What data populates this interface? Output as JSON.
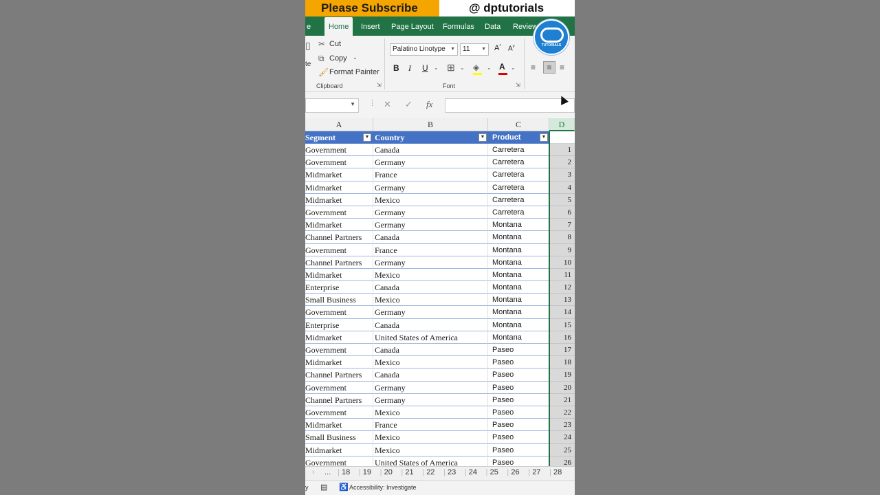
{
  "banner": {
    "subscribe": "Please Subscribe",
    "handle": "@ dptutorials"
  },
  "tabs": [
    {
      "label": "e",
      "active": false
    },
    {
      "label": "Home",
      "active": true
    },
    {
      "label": "Insert",
      "active": false
    },
    {
      "label": "Page Layout",
      "active": false
    },
    {
      "label": "Formulas",
      "active": false
    },
    {
      "label": "Data",
      "active": false
    },
    {
      "label": "Review",
      "active": false
    }
  ],
  "logo": {
    "text": "TUTORIALS",
    "color": "#1f7fd0"
  },
  "clipboard": {
    "paste_fragment": "te",
    "cut": "Cut",
    "copy": "Copy",
    "format_painter": "Format Painter",
    "group_label": "Clipboard"
  },
  "font": {
    "family": "Palatino Linotype",
    "size": "11",
    "bold": "B",
    "italic": "I",
    "underline": "U",
    "font_color_letter": "A",
    "group_label": "Font"
  },
  "formula_bar": {
    "fx": "fx",
    "value": ""
  },
  "columns": [
    "A",
    "B",
    "C",
    "D"
  ],
  "table": {
    "headers": [
      "Segment",
      "Country",
      "Product"
    ],
    "rows": [
      [
        "Government",
        "Canada",
        "Carretera",
        "1"
      ],
      [
        "Government",
        "Germany",
        "Carretera",
        "2"
      ],
      [
        "Midmarket",
        "France",
        "Carretera",
        "3"
      ],
      [
        "Midmarket",
        "Germany",
        "Carretera",
        "4"
      ],
      [
        "Midmarket",
        "Mexico",
        "Carretera",
        "5"
      ],
      [
        "Government",
        "Germany",
        "Carretera",
        "6"
      ],
      [
        "Midmarket",
        "Germany",
        "Montana",
        "7"
      ],
      [
        "Channel Partners",
        "Canada",
        "Montana",
        "8"
      ],
      [
        "Government",
        "France",
        "Montana",
        "9"
      ],
      [
        "Channel Partners",
        "Germany",
        "Montana",
        "10"
      ],
      [
        "Midmarket",
        "Mexico",
        "Montana",
        "11"
      ],
      [
        "Enterprise",
        "Canada",
        "Montana",
        "12"
      ],
      [
        "Small Business",
        "Mexico",
        "Montana",
        "13"
      ],
      [
        "Government",
        "Germany",
        "Montana",
        "14"
      ],
      [
        "Enterprise",
        "Canada",
        "Montana",
        "15"
      ],
      [
        "Midmarket",
        "United States of America",
        "Montana",
        "16"
      ],
      [
        "Government",
        "Canada",
        "Paseo",
        "17"
      ],
      [
        "Midmarket",
        "Mexico",
        "Paseo",
        "18"
      ],
      [
        "Channel Partners",
        "Canada",
        "Paseo",
        "19"
      ],
      [
        "Government",
        "Germany",
        "Paseo",
        "20"
      ],
      [
        "Channel Partners",
        "Germany",
        "Paseo",
        "21"
      ],
      [
        "Government",
        "Mexico",
        "Paseo",
        "22"
      ],
      [
        "Midmarket",
        "France",
        "Paseo",
        "23"
      ],
      [
        "Small Business",
        "Mexico",
        "Paseo",
        "24"
      ],
      [
        "Midmarket",
        "Mexico",
        "Paseo",
        "25"
      ],
      [
        "Government",
        "United States of America",
        "Paseo",
        "26"
      ]
    ]
  },
  "sheet_tabs": [
    "...",
    "18",
    "19",
    "20",
    "21",
    "22",
    "23",
    "24",
    "25",
    "26",
    "27",
    "28"
  ],
  "status": {
    "left": "y",
    "accessibility": "Accessibility: Investigate"
  },
  "colors": {
    "excel_green": "#217346",
    "table_header": "#4472c4",
    "banner_orange": "#f5a500"
  }
}
